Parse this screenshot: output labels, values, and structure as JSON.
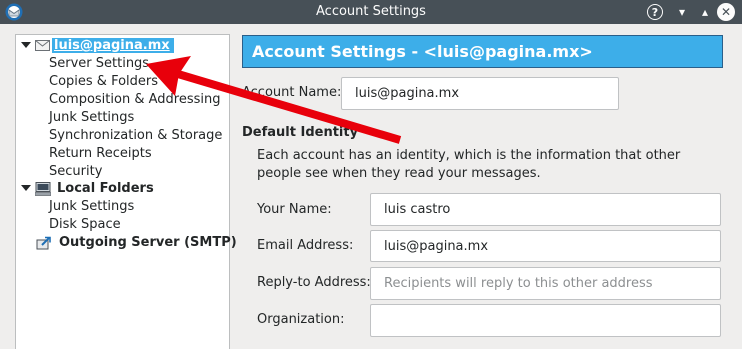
{
  "window": {
    "title": "Account Settings",
    "help_glyph": "?",
    "minimize_glyph": "▾",
    "maximize_glyph": "▴",
    "close_glyph": "✕"
  },
  "tree": {
    "account": {
      "label": "luis@pagina.mx",
      "icon": "envelope-icon",
      "expanded": true,
      "selected": true,
      "children": [
        "Server Settings",
        "Copies & Folders",
        "Composition & Addressing",
        "Junk Settings",
        "Synchronization & Storage",
        "Return Receipts",
        "Security"
      ]
    },
    "local_folders": {
      "label": "Local Folders",
      "icon": "computer-icon",
      "expanded": true,
      "children": [
        "Junk Settings",
        "Disk Space"
      ]
    },
    "outgoing": {
      "label": "Outgoing Server (SMTP)",
      "icon": "outgoing-server-icon"
    }
  },
  "settings": {
    "banner": "Account Settings - <luis@pagina.mx>",
    "account_name_label": "Account Name:",
    "account_name_value": "luis@pagina.mx",
    "identity_heading": "Default Identity",
    "identity_description": "Each account has an identity, which is the information that other people see when they read your messages.",
    "your_name_label": "Your Name:",
    "your_name_value": "luis castro",
    "email_label": "Email Address:",
    "email_value": "luis@pagina.mx",
    "reply_to_label": "Reply-to Address:",
    "reply_to_placeholder": "Recipients will reply to this other address",
    "organization_label": "Organization:",
    "organization_value": ""
  },
  "colors": {
    "titlebar": "#475057",
    "selection": "#3daee9",
    "annotation_arrow": "#e8000b"
  }
}
